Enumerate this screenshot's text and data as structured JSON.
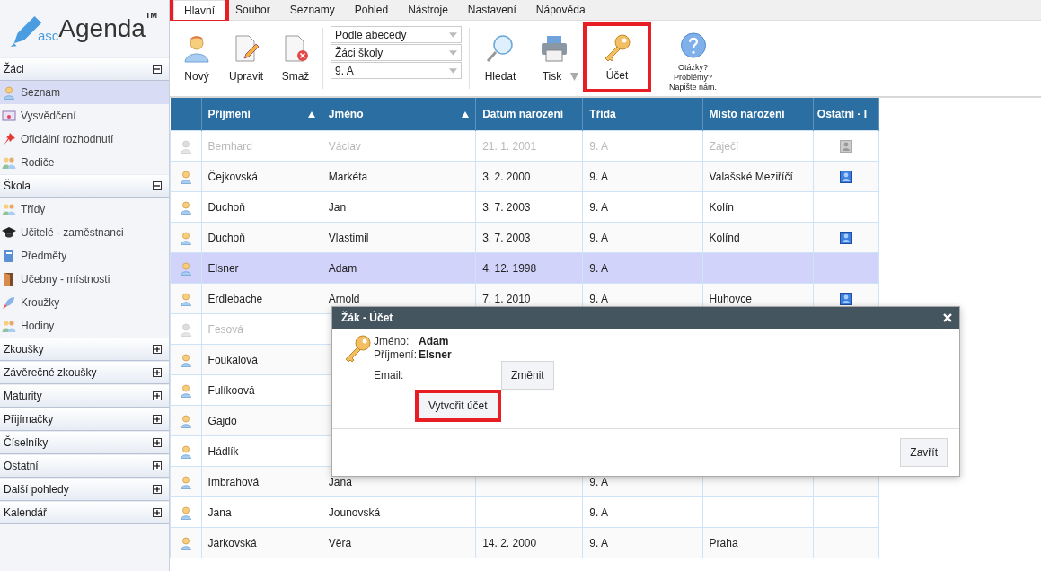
{
  "logo": {
    "prefix": "asc",
    "name": "Agenda",
    "mark": "TM"
  },
  "tabs": [
    {
      "label": "Hlavní",
      "selected": true,
      "highlighted": true
    },
    {
      "label": "Soubor",
      "selected": false,
      "highlighted": false
    },
    {
      "label": "Seznamy",
      "selected": false,
      "highlighted": false
    },
    {
      "label": "Pohled",
      "selected": false,
      "highlighted": false
    },
    {
      "label": "Nástroje",
      "selected": false,
      "highlighted": false
    },
    {
      "label": "Nastavení",
      "selected": false,
      "highlighted": false
    },
    {
      "label": "Nápověda",
      "selected": false,
      "highlighted": false
    }
  ],
  "ribbon_left": [
    {
      "kind": "person",
      "label": "Nový",
      "highlighted": false
    },
    {
      "kind": "edit",
      "label": "Upravit",
      "highlighted": false
    },
    {
      "kind": "delete",
      "label": "Smaž",
      "highlighted": false
    }
  ],
  "filters": [
    "Podle abecedy",
    "Žáci školy",
    "9. A"
  ],
  "ribbon_right": [
    {
      "kind": "search",
      "label": "Hledat",
      "highlighted": false,
      "dropdown": false
    },
    {
      "kind": "print",
      "label": "Tisk",
      "highlighted": false,
      "dropdown": true
    },
    {
      "kind": "key",
      "label": "Účet",
      "highlighted": true,
      "dropdown": false
    }
  ],
  "help": {
    "lines": [
      "Otázky?",
      "Problémy?",
      "Napište nám."
    ]
  },
  "sidebar": [
    {
      "title": "Žáci",
      "expanded": true,
      "items": [
        {
          "kind": "person",
          "label": "Seznam",
          "selected": true
        },
        {
          "kind": "certificate",
          "label": "Vysvědčení",
          "selected": false
        },
        {
          "kind": "pin",
          "label": "Oficiální rozhodnutí",
          "selected": false
        },
        {
          "kind": "parents",
          "label": "Rodiče",
          "selected": false
        }
      ]
    },
    {
      "title": "Škola",
      "expanded": true,
      "items": [
        {
          "kind": "group",
          "label": "Třídy",
          "selected": false
        },
        {
          "kind": "cap",
          "label": "Učitelé - zaměstnanci",
          "selected": false
        },
        {
          "kind": "book",
          "label": "Předměty",
          "selected": false
        },
        {
          "kind": "door",
          "label": "Učebny - místnosti",
          "selected": false
        },
        {
          "kind": "rocket",
          "label": "Kroužky",
          "selected": false
        },
        {
          "kind": "group",
          "label": "Hodiny",
          "selected": false
        }
      ]
    },
    {
      "title": "Zkoušky",
      "expanded": false
    },
    {
      "title": "Závěrečné zkoušky",
      "expanded": false
    },
    {
      "title": "Maturity",
      "expanded": false
    },
    {
      "title": "Přijímačky",
      "expanded": false
    },
    {
      "title": "Číselníky",
      "expanded": false
    },
    {
      "title": "Ostatní",
      "expanded": false
    },
    {
      "title": "Další pohledy",
      "expanded": false
    },
    {
      "title": "Kalendář",
      "expanded": false
    }
  ],
  "table": {
    "columns": [
      {
        "label": "Příjmení",
        "sorted": true
      },
      {
        "label": "Jméno",
        "sorted": true
      },
      {
        "label": "Datum narození",
        "sorted": false
      },
      {
        "label": "Třída",
        "sorted": false
      },
      {
        "label": "Místo narození",
        "sorted": false
      },
      {
        "label": "Ostatní - I",
        "sorted": false
      }
    ],
    "rows": [
      {
        "disabled": true,
        "selected": false,
        "account": true,
        "cells": [
          "Bernhard",
          "Václav",
          "21. 1. 2001",
          "9. A",
          "Zaječí"
        ]
      },
      {
        "disabled": false,
        "selected": false,
        "account": true,
        "cells": [
          "Čejkovská",
          "Markéta",
          "3. 2. 2000",
          "9. A",
          "Valašské Meziříčí"
        ]
      },
      {
        "disabled": false,
        "selected": false,
        "account": false,
        "cells": [
          "Duchoň",
          "Jan",
          "3. 7. 2003",
          "9. A",
          "Kolín"
        ]
      },
      {
        "disabled": false,
        "selected": false,
        "account": true,
        "cells": [
          "Duchoň",
          "Vlastimil",
          "3. 7. 2003",
          "9. A",
          "Kolínd"
        ]
      },
      {
        "disabled": false,
        "selected": true,
        "account": false,
        "cells": [
          "Elsner",
          "Adam",
          "4. 12. 1998",
          "9. A",
          ""
        ]
      },
      {
        "disabled": false,
        "selected": false,
        "account": true,
        "cells": [
          "Erdlebache",
          "Arnold",
          "7. 1. 2010",
          "9. A",
          "Huhovce"
        ]
      },
      {
        "disabled": true,
        "selected": false,
        "account": false,
        "cells": [
          "Fesová"
        ]
      },
      {
        "disabled": false,
        "selected": false,
        "account": false,
        "cells": [
          "Foukalová"
        ]
      },
      {
        "disabled": false,
        "selected": false,
        "account": false,
        "cells": [
          "Fulíkoová"
        ]
      },
      {
        "disabled": false,
        "selected": false,
        "account": false,
        "cells": [
          "Gajdo"
        ]
      },
      {
        "disabled": false,
        "selected": false,
        "account": false,
        "cells": [
          "Hádlík"
        ]
      },
      {
        "disabled": false,
        "selected": false,
        "account": false,
        "cells": [
          "Imbrahová",
          "Jana",
          "",
          "9. A",
          ""
        ]
      },
      {
        "disabled": false,
        "selected": false,
        "account": false,
        "cells": [
          "Jana",
          "Jounovská",
          "",
          "9. A",
          ""
        ]
      },
      {
        "disabled": false,
        "selected": false,
        "account": false,
        "cells": [
          "Jarkovská",
          "Věra",
          "14. 2. 2000",
          "9. A",
          "Praha"
        ]
      }
    ]
  },
  "dialog": {
    "title": "Žák - Účet",
    "fields": [
      {
        "label": "Jméno:",
        "value": "Adam"
      },
      {
        "label": "Příjmení:",
        "value": "Elsner"
      },
      {
        "label": "Email:"
      }
    ],
    "change_button": {
      "label": "Změnit",
      "highlighted": false
    },
    "create_button": {
      "label": "Vytvořit účet",
      "highlighted": true
    },
    "close_button": {
      "label": "Zavřít",
      "highlighted": false
    }
  }
}
